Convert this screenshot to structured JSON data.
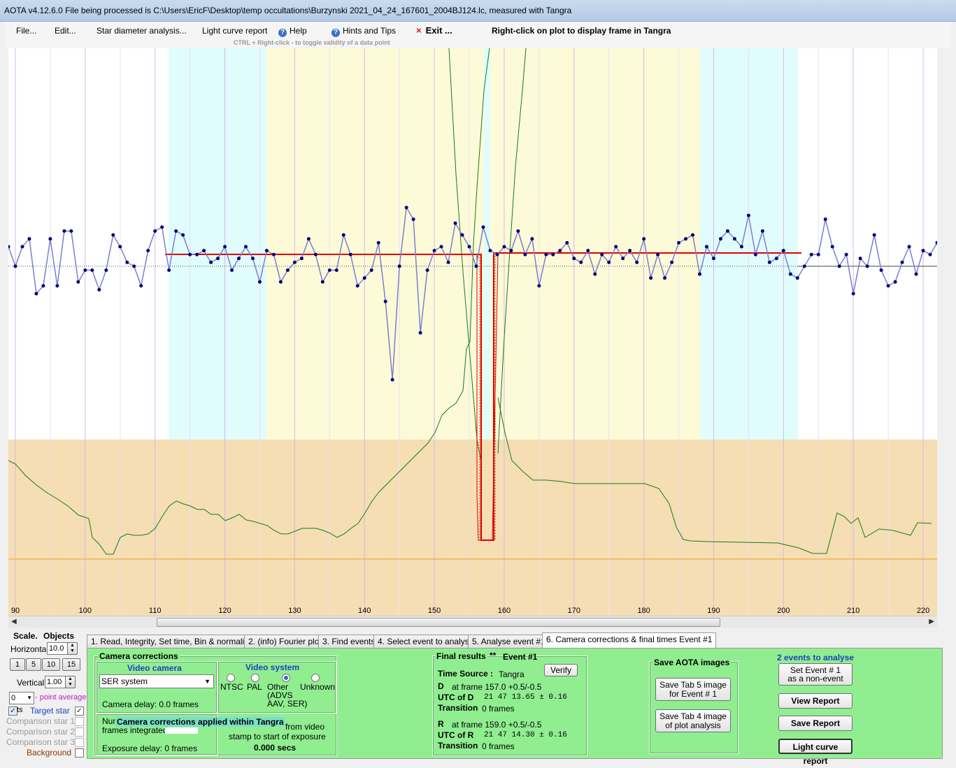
{
  "window": {
    "title": "AOTA v4.12.6.0    File being processed is C:\\Users\\EricF\\Desktop\\temp occultations\\Burzynski 2021_04_24_167601_2004BJ124.lc, measured with Tangra"
  },
  "menu": {
    "file": "File...",
    "edit": "Edit...",
    "star_diameter": "Star diameter analysis...",
    "light_curve_report": "Light curve report",
    "help": "Help",
    "hints": "Hints and Tips",
    "exit": "Exit ...",
    "exit_icon": "×",
    "right_click_hint": "Right-click on plot to display frame in Tangra",
    "ctrl_hint": "CTRL + Right-click  -  to toggle validity of a data point"
  },
  "chart_data": {
    "type": "line",
    "x_ticks": [
      "90",
      "100",
      "110",
      "120",
      "130",
      "140",
      "150",
      "160",
      "170",
      "180",
      "190",
      "200",
      "210",
      "220"
    ],
    "xlim": [
      89,
      222
    ],
    "series": [
      {
        "values": [
          14,
          9,
          14,
          16,
          2,
          4,
          16,
          4,
          18,
          18,
          5,
          8,
          8,
          3,
          8,
          17,
          14,
          10,
          9,
          4,
          13,
          18,
          19,
          8,
          18,
          17,
          12,
          12,
          13,
          10,
          11,
          14,
          8,
          11,
          14,
          11,
          5,
          13,
          12,
          5,
          8,
          10,
          11,
          16,
          12,
          5,
          8,
          8,
          17,
          12,
          4,
          6,
          8,
          15,
          0,
          -20,
          9,
          24,
          21,
          -8,
          8,
          13,
          14,
          10,
          20,
          17,
          14,
          9,
          19,
          13,
          12,
          14,
          13,
          18,
          12,
          16,
          4,
          12,
          12,
          13,
          15,
          11,
          10,
          13,
          7,
          12,
          10,
          14,
          11,
          13,
          10,
          16,
          6,
          12,
          6,
          10,
          15,
          16,
          17,
          7,
          14,
          11,
          16,
          18,
          16,
          14,
          22,
          12,
          18,
          10,
          11,
          13,
          7,
          6,
          9,
          12,
          12,
          21,
          14,
          9,
          12,
          2,
          11,
          9,
          17,
          8,
          4,
          5,
          10,
          14,
          7,
          13,
          12,
          15,
          12,
          14,
          6,
          2,
          9,
          7,
          6,
          10,
          5,
          7,
          8
        ]
      }
    ],
    "annotations": {
      "event_frame_D": 157.0,
      "event_frame_R": 159.0
    }
  },
  "scale_panel": {
    "title_scale": "Scale.",
    "title_objects": "Objects",
    "horizontal_label": "Horizontal",
    "horizontal_value": "10.0",
    "zoom_buttons": [
      "1",
      "5",
      "10",
      "15"
    ],
    "vertical_label": "Vertical",
    "vertical_value": "1.00",
    "point_average_value": "0",
    "point_average_label": "- point average",
    "pts_label": "ts",
    "target_star": "Target star",
    "comparison": [
      "Comparison star 1",
      "Comparison star 2",
      "Comparison star 3"
    ],
    "background": "Background",
    "check_mark": "✓"
  },
  "tabs": [
    "1.  Read, Integrity, Set time, Bin & normalise",
    "2. (info)  Fourier plot",
    "3. Find events",
    "4. Select event to analyse",
    "5. Analyse event #1",
    "6. Camera corrections & final times Event #1"
  ],
  "camera": {
    "title": "Camera corrections",
    "video_camera_title": "Video camera",
    "camera_select": "SER system",
    "camera_delay": "Camera delay: 0.0 frames",
    "video_system_title": "Video system",
    "radios": [
      "NTSC",
      "PAL",
      "Other",
      "Unknown"
    ],
    "other_note": "(ADVS\nAAV, SER)",
    "applied_banner": "Camera corrections applied within Tangra",
    "frames_integrated_a": "Num",
    "frames_integrated_b": "frames integrated",
    "from_video": "from video",
    "stamp_text": "stamp to start of exposure",
    "secs": "0.000 secs",
    "exposure_delay": "Exposure delay: 0 frames"
  },
  "final": {
    "title": "Final results",
    "stars": "**",
    "event": "Event #1",
    "time_source_label": "Time Source :",
    "time_source_value": "Tangra",
    "verify": "Verify",
    "D_label": "D",
    "D_frame": "at frame 157.0  +0.5/-0.5",
    "utc_d_label": "UTC of D",
    "utc_d_value": "21 47 13.65  ± 0.16",
    "transition_label": "Transition",
    "transition_d": "0 frames",
    "R_label": "R",
    "R_frame": "at frame 159.0  +0.5/-0.5",
    "utc_r_label": "UTC of R",
    "utc_r_value": "21 47 14.30  ± 0.16",
    "transition_r": "0 frames"
  },
  "save": {
    "title": "Save AOTA images",
    "tab5": "Save Tab 5 image\nfor Event # 1",
    "tab4": "Save Tab 4 image\nof plot analysis"
  },
  "events": {
    "count_title": "2  events to analyse",
    "non_event": "Set Event # 1\nas a non-event",
    "view_report": "View Report",
    "save_report": "Save Report",
    "lc_report": "Light curve report"
  }
}
